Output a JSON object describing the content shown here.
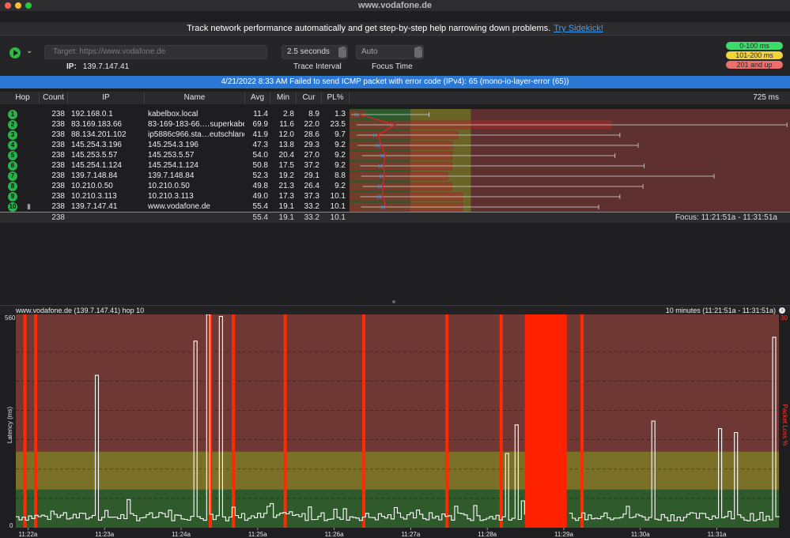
{
  "window": {
    "title": "www.vodafone.de"
  },
  "promo": {
    "text": "Track network performance automatically and get step-by-step help narrowing down problems.",
    "link": "Try Sidekick!"
  },
  "toolbar": {
    "menu_glyph": "⌄",
    "target_placeholder": "Target:  https://www.vodafone.de",
    "ip_label": "IP:",
    "ip_value": "139.7.147.41",
    "interval_value": "2.5 seconds",
    "interval_label": "Trace Interval",
    "focus_value": "Auto",
    "focus_label": "Focus Time",
    "stepper_glyph": "⌃⌄"
  },
  "legend": [
    {
      "label": "0-100 ms",
      "color": "#3ddc6a"
    },
    {
      "label": "101-200 ms",
      "color": "#f4d33a"
    },
    {
      "label": "201 and up",
      "color": "#ee6d6d"
    }
  ],
  "alert": {
    "text": "4/21/2022 8:33 AM Failed to send ICMP packet with error code (IPv4): 65 (mono-io-layer-error (65))"
  },
  "table": {
    "columns": [
      "Hop",
      "Count",
      "IP",
      "Name",
      "Avg",
      "Min",
      "Cur",
      "PL%"
    ],
    "scale_label": "725 ms",
    "rows": [
      {
        "hop": "1",
        "count": "238",
        "ip": "192.168.0.1",
        "name": "kabelbox.local",
        "avg": "11.4",
        "min": "2.8",
        "cur": "8.9",
        "pl": "1.3",
        "avg_ms": 11.4,
        "min_ms": 2.8,
        "max_ms": 131,
        "pl_pct": 1.3
      },
      {
        "hop": "2",
        "count": "238",
        "ip": "83.169.183.66",
        "name": "83-169-183-66.…superkabel.de",
        "avg": "69.9",
        "min": "11.6",
        "cur": "22.0",
        "pl": "23.5",
        "avg_ms": 69.9,
        "min_ms": 11.6,
        "max_ms": 720,
        "pl_pct": 23.5
      },
      {
        "hop": "3",
        "count": "238",
        "ip": "88.134.201.102",
        "name": "ip5886c966.sta…eutschland.de",
        "avg": "41.9",
        "min": "12.0",
        "cur": "28.6",
        "pl": "9.7",
        "avg_ms": 41.9,
        "min_ms": 12.0,
        "max_ms": 445,
        "pl_pct": 9.7
      },
      {
        "hop": "4",
        "count": "238",
        "ip": "145.254.3.196",
        "name": "145.254.3.196",
        "avg": "47.3",
        "min": "13.8",
        "cur": "29.3",
        "pl": "9.2",
        "avg_ms": 47.3,
        "min_ms": 13.8,
        "max_ms": 475,
        "pl_pct": 9.2
      },
      {
        "hop": "5",
        "count": "238",
        "ip": "145.253.5.57",
        "name": "145.253.5.57",
        "avg": "54.0",
        "min": "20.4",
        "cur": "27.0",
        "pl": "9.2",
        "avg_ms": 54.0,
        "min_ms": 20.4,
        "max_ms": 437,
        "pl_pct": 9.2
      },
      {
        "hop": "6",
        "count": "238",
        "ip": "145.254.1.124",
        "name": "145.254.1.124",
        "avg": "50.8",
        "min": "17.5",
        "cur": "37.2",
        "pl": "9.2",
        "avg_ms": 50.8,
        "min_ms": 17.5,
        "max_ms": 485,
        "pl_pct": 9.2
      },
      {
        "hop": "7",
        "count": "238",
        "ip": "139.7.148.84",
        "name": "139.7.148.84",
        "avg": "52.3",
        "min": "19.2",
        "cur": "29.1",
        "pl": "8.8",
        "avg_ms": 52.3,
        "min_ms": 19.2,
        "max_ms": 600,
        "pl_pct": 8.8
      },
      {
        "hop": "8",
        "count": "238",
        "ip": "10.210.0.50",
        "name": "10.210.0.50",
        "avg": "49.8",
        "min": "21.3",
        "cur": "26.4",
        "pl": "9.2",
        "avg_ms": 49.8,
        "min_ms": 21.3,
        "max_ms": 483,
        "pl_pct": 9.2
      },
      {
        "hop": "9",
        "count": "238",
        "ip": "10.210.3.113",
        "name": "10.210.3.113",
        "avg": "49.0",
        "min": "17.3",
        "cur": "37.3",
        "pl": "10.1",
        "avg_ms": 49.0,
        "min_ms": 17.3,
        "max_ms": 445,
        "pl_pct": 10.1
      },
      {
        "hop": "10",
        "count": "238",
        "ip": "139.7.147.41",
        "name": "www.vodafone.de",
        "avg": "55.4",
        "min": "19.1",
        "cur": "33.2",
        "pl": "10.1",
        "avg_ms": 55.4,
        "min_ms": 19.1,
        "max_ms": 410,
        "pl_pct": 10.1
      }
    ],
    "totals": {
      "count": "238",
      "avg": "55.4",
      "min": "19.1",
      "cur": "33.2",
      "pl": "10.1",
      "focus": "Focus: 11:21:51a - 11:31:51a"
    }
  },
  "graph": {
    "title": "www.vodafone.de (139.7.147.41) hop 10",
    "range": "10 minutes (11:21:51a - 11:31:51a)",
    "info_icon": "i",
    "y_left_label": "Latency (ms)",
    "y_right_label": "Packet Loss %",
    "y_left_ticks": [
      "560",
      "0"
    ],
    "y_right_ticks": [
      "30"
    ],
    "y_max_ms": 560,
    "x_ticks": [
      "11:22a",
      "11:23a",
      "11:24a",
      "11:25a",
      "11:26a",
      "11:27a",
      "11:28a",
      "11:29a",
      "11:30a",
      "11:31a"
    ],
    "zones": [
      {
        "from_ms": 0,
        "to_ms": 100,
        "color": "#2f5a2c"
      },
      {
        "from_ms": 100,
        "to_ms": 200,
        "color": "#7a7028"
      },
      {
        "from_ms": 200,
        "to_ms": 560,
        "color": "#6f3835"
      }
    ],
    "grid_ms": [
      77,
      154,
      231,
      308,
      385,
      462
    ],
    "loss_bars_frac": [
      0.012,
      0.026,
      0.255,
      0.285,
      0.353,
      0.456,
      0.565,
      0.636,
      0.742
    ],
    "outage": {
      "from_frac": 0.667,
      "to_frac": 0.722
    },
    "spikes": [
      {
        "frac": 0.105,
        "ms": 400
      },
      {
        "frac": 0.235,
        "ms": 490
      },
      {
        "frac": 0.252,
        "ms": 560
      },
      {
        "frac": 0.267,
        "ms": 555
      },
      {
        "frac": 0.643,
        "ms": 195
      },
      {
        "frac": 0.655,
        "ms": 270
      },
      {
        "frac": 0.835,
        "ms": 280
      },
      {
        "frac": 0.92,
        "ms": 260
      },
      {
        "frac": 0.94,
        "ms": 250
      },
      {
        "frac": 0.99,
        "ms": 500
      }
    ],
    "sample_line": "#ffffff"
  }
}
